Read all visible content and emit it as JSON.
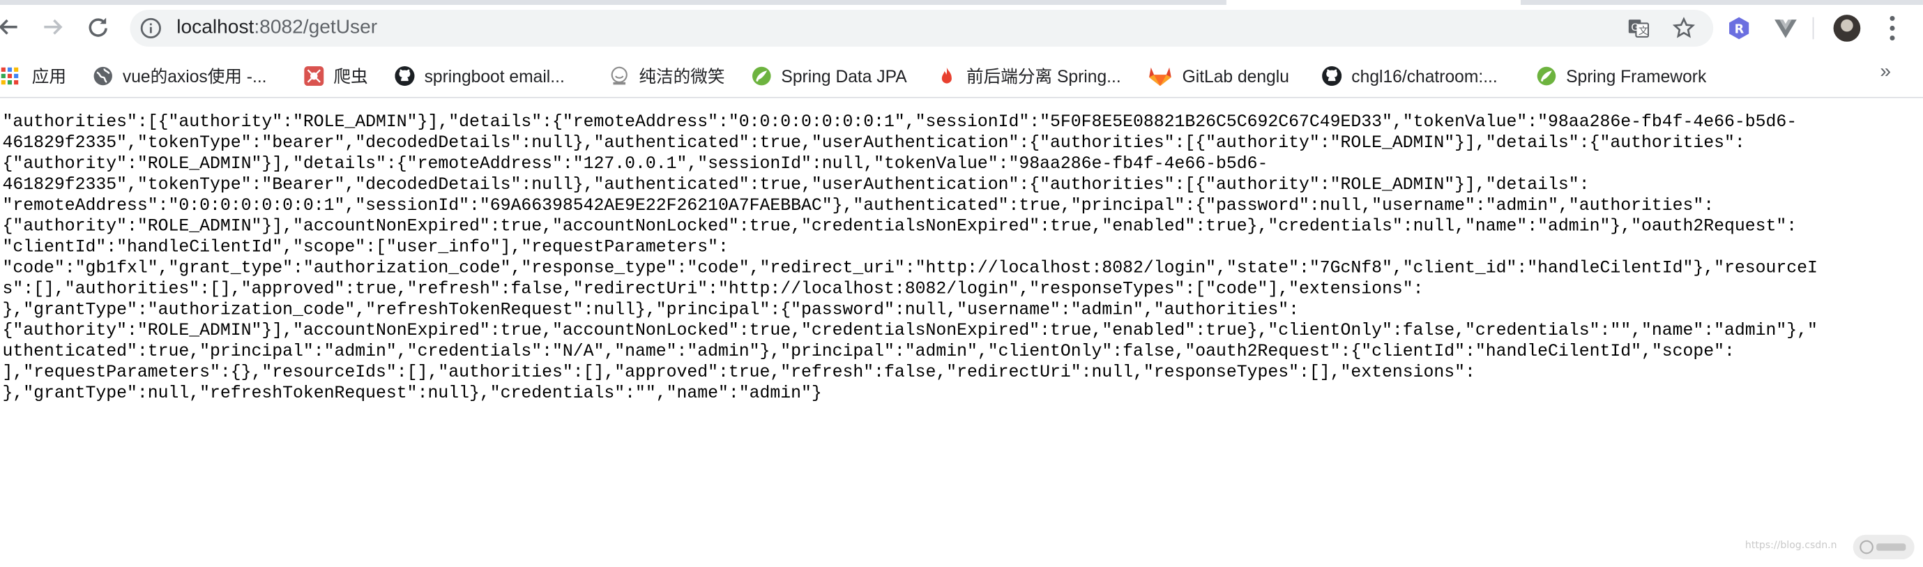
{
  "browser": {
    "url_host": "localhost",
    "url_rest": ":8082/getUser",
    "extensions": [
      "r-extension-icon",
      "vue-devtools-icon"
    ]
  },
  "bookmarks": [
    {
      "label": "应用",
      "icon": "apps-grid-icon"
    },
    {
      "label": "vue的axios使用 -...",
      "icon": "globe-icon"
    },
    {
      "label": "爬虫",
      "icon": "spider-icon"
    },
    {
      "label": "springboot email...",
      "icon": "github-icon"
    },
    {
      "label": "纯洁的微笑",
      "icon": "site-icon"
    },
    {
      "label": "Spring Data JPA",
      "icon": "spring-icon"
    },
    {
      "label": "前后端分离 Spring...",
      "icon": "flame-icon"
    },
    {
      "label": "GitLab denglu",
      "icon": "gitlab-icon"
    },
    {
      "label": "chgl16/chatroom:...",
      "icon": "github-icon"
    },
    {
      "label": "Spring Framework",
      "icon": "spring-icon"
    }
  ],
  "bookmarks_more": "»",
  "json_lines": [
    "\"authorities\":[{\"authority\":\"ROLE_ADMIN\"}],\"details\":{\"remoteAddress\":\"0:0:0:0:0:0:0:1\",\"sessionId\":\"5F0F8E5E08821B26C5C692C67C49ED33\",\"tokenValue\":\"98aa286e-fb4f-4e66-b5d6-",
    "461829f2335\",\"tokenType\":\"bearer\",\"decodedDetails\":null},\"authenticated\":true,\"userAuthentication\":{\"authorities\":[{\"authority\":\"ROLE_ADMIN\"}],\"details\":{\"authorities\":",
    "{\"authority\":\"ROLE_ADMIN\"}],\"details\":{\"remoteAddress\":\"127.0.0.1\",\"sessionId\":null,\"tokenValue\":\"98aa286e-fb4f-4e66-b5d6-",
    "461829f2335\",\"tokenType\":\"Bearer\",\"decodedDetails\":null},\"authenticated\":true,\"userAuthentication\":{\"authorities\":[{\"authority\":\"ROLE_ADMIN\"}],\"details\":",
    "\"remoteAddress\":\"0:0:0:0:0:0:0:1\",\"sessionId\":\"69A66398542AE9E22F26210A7FAEBBAC\"},\"authenticated\":true,\"principal\":{\"password\":null,\"username\":\"admin\",\"authorities\":",
    "{\"authority\":\"ROLE_ADMIN\"}],\"accountNonExpired\":true,\"accountNonLocked\":true,\"credentialsNonExpired\":true,\"enabled\":true},\"credentials\":null,\"name\":\"admin\"},\"oauth2Request\":",
    "\"clientId\":\"handleCilentId\",\"scope\":[\"user_info\"],\"requestParameters\":",
    "\"code\":\"gb1fxl\",\"grant_type\":\"authorization_code\",\"response_type\":\"code\",\"redirect_uri\":\"http://localhost:8082/login\",\"state\":\"7GcNf8\",\"client_id\":\"handleCilentId\"},\"resourceI",
    "s\":[],\"authorities\":[],\"approved\":true,\"refresh\":false,\"redirectUri\":\"http://localhost:8082/login\",\"responseTypes\":[\"code\"],\"extensions\":",
    "},\"grantType\":\"authorization_code\",\"refreshTokenRequest\":null},\"principal\":{\"password\":null,\"username\":\"admin\",\"authorities\":",
    "{\"authority\":\"ROLE_ADMIN\"}],\"accountNonExpired\":true,\"accountNonLocked\":true,\"credentialsNonExpired\":true,\"enabled\":true},\"clientOnly\":false,\"credentials\":\"\",\"name\":\"admin\"},\"",
    "uthenticated\":true,\"principal\":\"admin\",\"credentials\":\"N/A\",\"name\":\"admin\"},\"principal\":\"admin\",\"clientOnly\":false,\"oauth2Request\":{\"clientId\":\"handleCilentId\",\"scope\":",
    "],\"requestParameters\":{},\"resourceIds\":[],\"authorities\":[],\"approved\":true,\"refresh\":false,\"redirectUri\":null,\"responseTypes\":[],\"extensions\":",
    "},\"grantType\":null,\"refreshTokenRequest\":null},\"credentials\":\"\",\"name\":\"admin\"}"
  ],
  "watermark": "https://blog.csdn.n"
}
